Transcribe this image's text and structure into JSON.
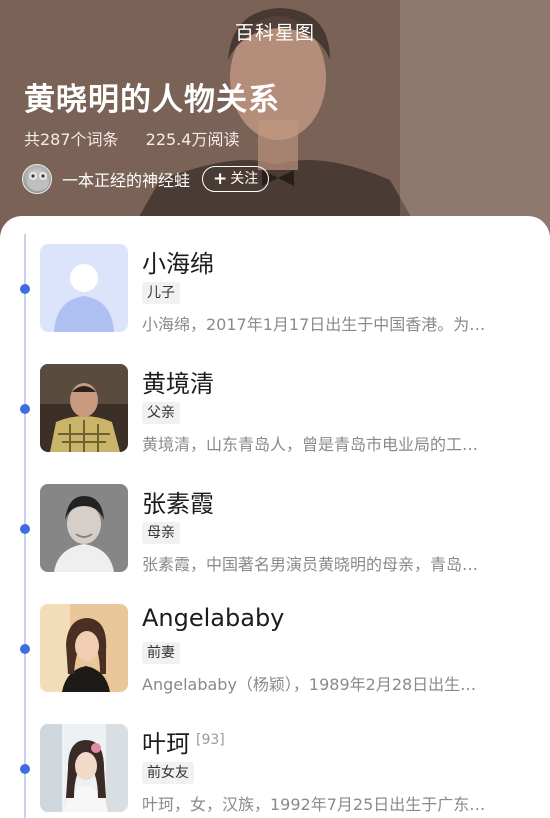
{
  "header": {
    "title": "百科星图",
    "heading": "黄晓明的人物关系",
    "entries_count": "共287个词条",
    "reads": "225.4万阅读",
    "author": "一本正经的神经蛙",
    "follow_label": "关注",
    "follow_icon": "plus-icon"
  },
  "colors": {
    "accent": "#3d6ddf",
    "timeline": "#c8d2ec",
    "header_bg": "#7c6459"
  },
  "relations": [
    {
      "name": "小海绵",
      "relation": "儿子",
      "desc": "小海绵，2017年1月17日出生于中国香港。为…",
      "citation": ""
    },
    {
      "name": "黄境清",
      "relation": "父亲",
      "desc": "黄境清，山东青岛人，曾是青岛市电业局的工…",
      "citation": ""
    },
    {
      "name": "张素霞",
      "relation": "母亲",
      "desc": "张素霞，中国著名男演员黄晓明的母亲，青岛…",
      "citation": ""
    },
    {
      "name": "Angelababy",
      "relation": "前妻",
      "desc": "Angelababy（杨颖），1989年2月28日出生…",
      "citation": ""
    },
    {
      "name": "叶珂",
      "relation": "前女友",
      "desc": "叶珂，女，汉族，1992年7月25日出生于广东…",
      "citation": "[93]"
    }
  ]
}
